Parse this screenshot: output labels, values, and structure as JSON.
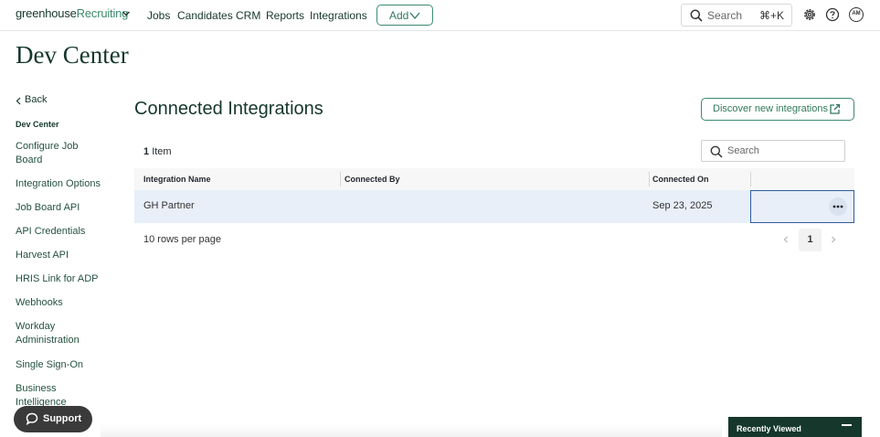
{
  "nav": {
    "logo_part1": "greenhouse",
    "logo_part2": "Recruiting",
    "links": [
      "Jobs",
      "Candidates",
      "CRM",
      "Reports",
      "Integrations"
    ],
    "add_label": "Add",
    "search_placeholder": "Search",
    "search_shortcut": "⌘+K",
    "avatar_initials": "AM",
    "icons": [
      "chevron-down-icon",
      "search-icon",
      "gear-icon",
      "help-icon"
    ]
  },
  "page_title": "Dev Center",
  "sidebar": {
    "back_label": "Back",
    "section_title": "Dev Center",
    "items": [
      "Configure Job Board",
      "Integration Options",
      "Job Board API",
      "API Credentials",
      "Harvest API",
      "HRIS Link for ADP",
      "Webhooks",
      "Workday Administration",
      "Single Sign-On",
      "Business Intelligence"
    ]
  },
  "main": {
    "title": "Connected Integrations",
    "discover_label": "Discover new integrations",
    "count_number": "1",
    "count_label": "Item",
    "search_placeholder": "Search",
    "columns": [
      "Integration Name",
      "Connected By",
      "Connected On"
    ],
    "rows": [
      {
        "name": "GH Partner",
        "connected_by": "",
        "connected_on": "Sep 23, 2025"
      }
    ],
    "rows_per_page": "10 rows per page",
    "current_page": "1"
  },
  "support_label": "Support",
  "recently_viewed_label": "Recently Viewed",
  "colors": {
    "brand_dark": "#15372c",
    "brand_green": "#3d8a6d",
    "selected_row": "#e8eff8",
    "focus_border": "#2e5c9c"
  }
}
